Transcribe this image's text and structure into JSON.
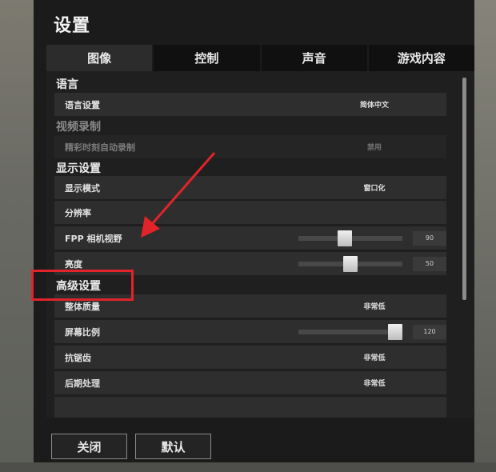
{
  "dialog": {
    "title": "设置"
  },
  "tabs": [
    {
      "label": "图像",
      "active": true
    },
    {
      "label": "控制",
      "active": false
    },
    {
      "label": "声音",
      "active": false
    },
    {
      "label": "游戏内容",
      "active": false
    }
  ],
  "sections": {
    "language": "语言",
    "video_recording": "视频录制",
    "display": "显示设置",
    "advanced": "高级设置"
  },
  "settings": {
    "language_setting": {
      "label": "语言设置",
      "value": "简体中文"
    },
    "highlight_auto_record": {
      "label": "精彩时刻自动录制",
      "value": "禁用",
      "disabled": true
    },
    "display_mode": {
      "label": "显示模式",
      "value": "窗口化"
    },
    "resolution": {
      "label": "分辨率",
      "value": ""
    },
    "fpp_camera_fov": {
      "label": "FPP 相机视野",
      "value": "90",
      "slider_fraction": 0.44
    },
    "brightness": {
      "label": "亮度",
      "value": "50",
      "slider_fraction": 0.5
    },
    "overall_quality": {
      "label": "整体质量",
      "value": "非常低"
    },
    "screen_scale": {
      "label": "屏幕比例",
      "value": "120",
      "slider_fraction": 1.0
    },
    "anti_aliasing": {
      "label": "抗锯齿",
      "value": "非常低"
    },
    "post_processing": {
      "label": "后期处理",
      "value": "非常低"
    }
  },
  "footer": {
    "close_label": "关闭",
    "default_label": "默认"
  },
  "colors": {
    "annotation_red": "#e0242a",
    "panel_bg": "#1b1b1b",
    "row_bg": "#2e2e2e"
  }
}
